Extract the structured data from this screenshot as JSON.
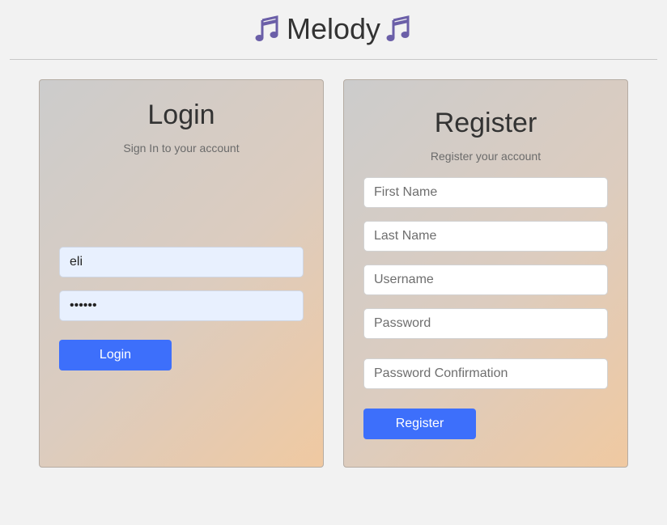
{
  "app": {
    "title": "Melody",
    "icon": "music-notes-icon",
    "accent_color": "#6b5fa8"
  },
  "login": {
    "title": "Login",
    "subtitle": "Sign In to your account",
    "username_value": "eli",
    "password_value": "elieli",
    "button_label": "Login"
  },
  "register": {
    "title": "Register",
    "subtitle": "Register your account",
    "first_name_placeholder": "First Name",
    "last_name_placeholder": "Last Name",
    "username_placeholder": "Username",
    "password_placeholder": "Password",
    "password_confirmation_placeholder": "Password Confirmation",
    "button_label": "Register"
  },
  "colors": {
    "button": "#3d6ffb",
    "page_background": "#f2f2f2"
  }
}
